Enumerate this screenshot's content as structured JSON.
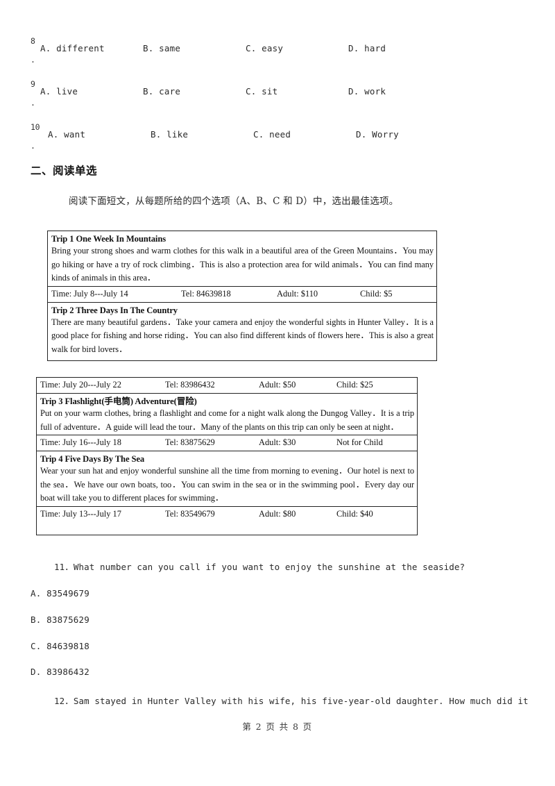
{
  "cloze": {
    "rows": [
      {
        "number": "8",
        "dot": ".",
        "options": [
          "A. different",
          "B. same",
          "C. easy",
          "D. hard"
        ]
      },
      {
        "number": "9",
        "dot": ".",
        "options": [
          "A. live",
          "B. care",
          "C. sit",
          "D. work"
        ]
      },
      {
        "number": "10",
        "dot": ".",
        "options": [
          "A. want",
          "B. like",
          "C. need",
          "D. Worry"
        ]
      }
    ]
  },
  "section": {
    "heading": "二、阅读单选",
    "instruction": "阅读下面短文，从每题所给的四个选项（A、B、C 和 D）中，选出最佳选项。"
  },
  "passage_box_1": {
    "trip1": {
      "title": "Trip 1 One Week In Mountains",
      "body": "Bring your strong shoes and warm clothes for this walk in a beautiful area of the Green Mountains．You may go hiking or have a try of rock climbing．This is also a protection area for wild animals．You can find many kinds of animals in this area．",
      "time": "Time: July 8---July 14",
      "tel": "Tel: 84639818",
      "adult": "Adult: $110",
      "child": "Child: $5"
    },
    "trip2": {
      "title": "Trip 2 Three Days In The Country",
      "body": "There are many beautiful gardens．Take your camera and enjoy the wonderful sights in Hunter Valley．It is a good place for fishing and horse riding．You can also find different kinds of flowers here．This is also a great walk for bird lovers．"
    }
  },
  "passage_box_2": {
    "trip2_info": {
      "time": "Time: July 20---July 22",
      "tel": "Tel: 83986432",
      "adult": "Adult: $50",
      "child": "Child: $25"
    },
    "trip3": {
      "title": "Trip 3 Flashlight(手电筒) Adventure(冒险)",
      "body": "Put on your warm clothes, bring a flashlight and come for a night walk along the Dungog Valley．It is a trip full of adventure．A guide will lead the tour．Many of the plants on this trip can only be seen at night．",
      "time": "Time: July 16---July 18",
      "tel": "Tel: 83875629",
      "adult": "Adult: $30",
      "child": "Not for Child"
    },
    "trip4": {
      "title": "Trip 4 Five Days By The Sea",
      "body": "Wear your sun hat and enjoy wonderful sunshine all the time from morning to evening．Our hotel is next to the sea．We have our own boats, too．You can swim in the sea or in the swimming pool．Every day our boat will take you to different places for swimming．",
      "time": "Time: July 13---July 17",
      "tel": "Tel: 83549679",
      "adult": "Adult: $80",
      "child": "Child: $40"
    }
  },
  "questions": [
    {
      "stem": "11．What number can you call if you want to enjoy the sunshine at the seaside?",
      "options": [
        "A. 83549679",
        "B. 83875629",
        "C. 84639818",
        "D. 83986432"
      ]
    },
    {
      "stem": "12．Sam stayed in Hunter Valley with his wife, his five-year-old daughter. How much did it"
    }
  ],
  "footer": {
    "text": "第 2 页 共 8 页"
  }
}
